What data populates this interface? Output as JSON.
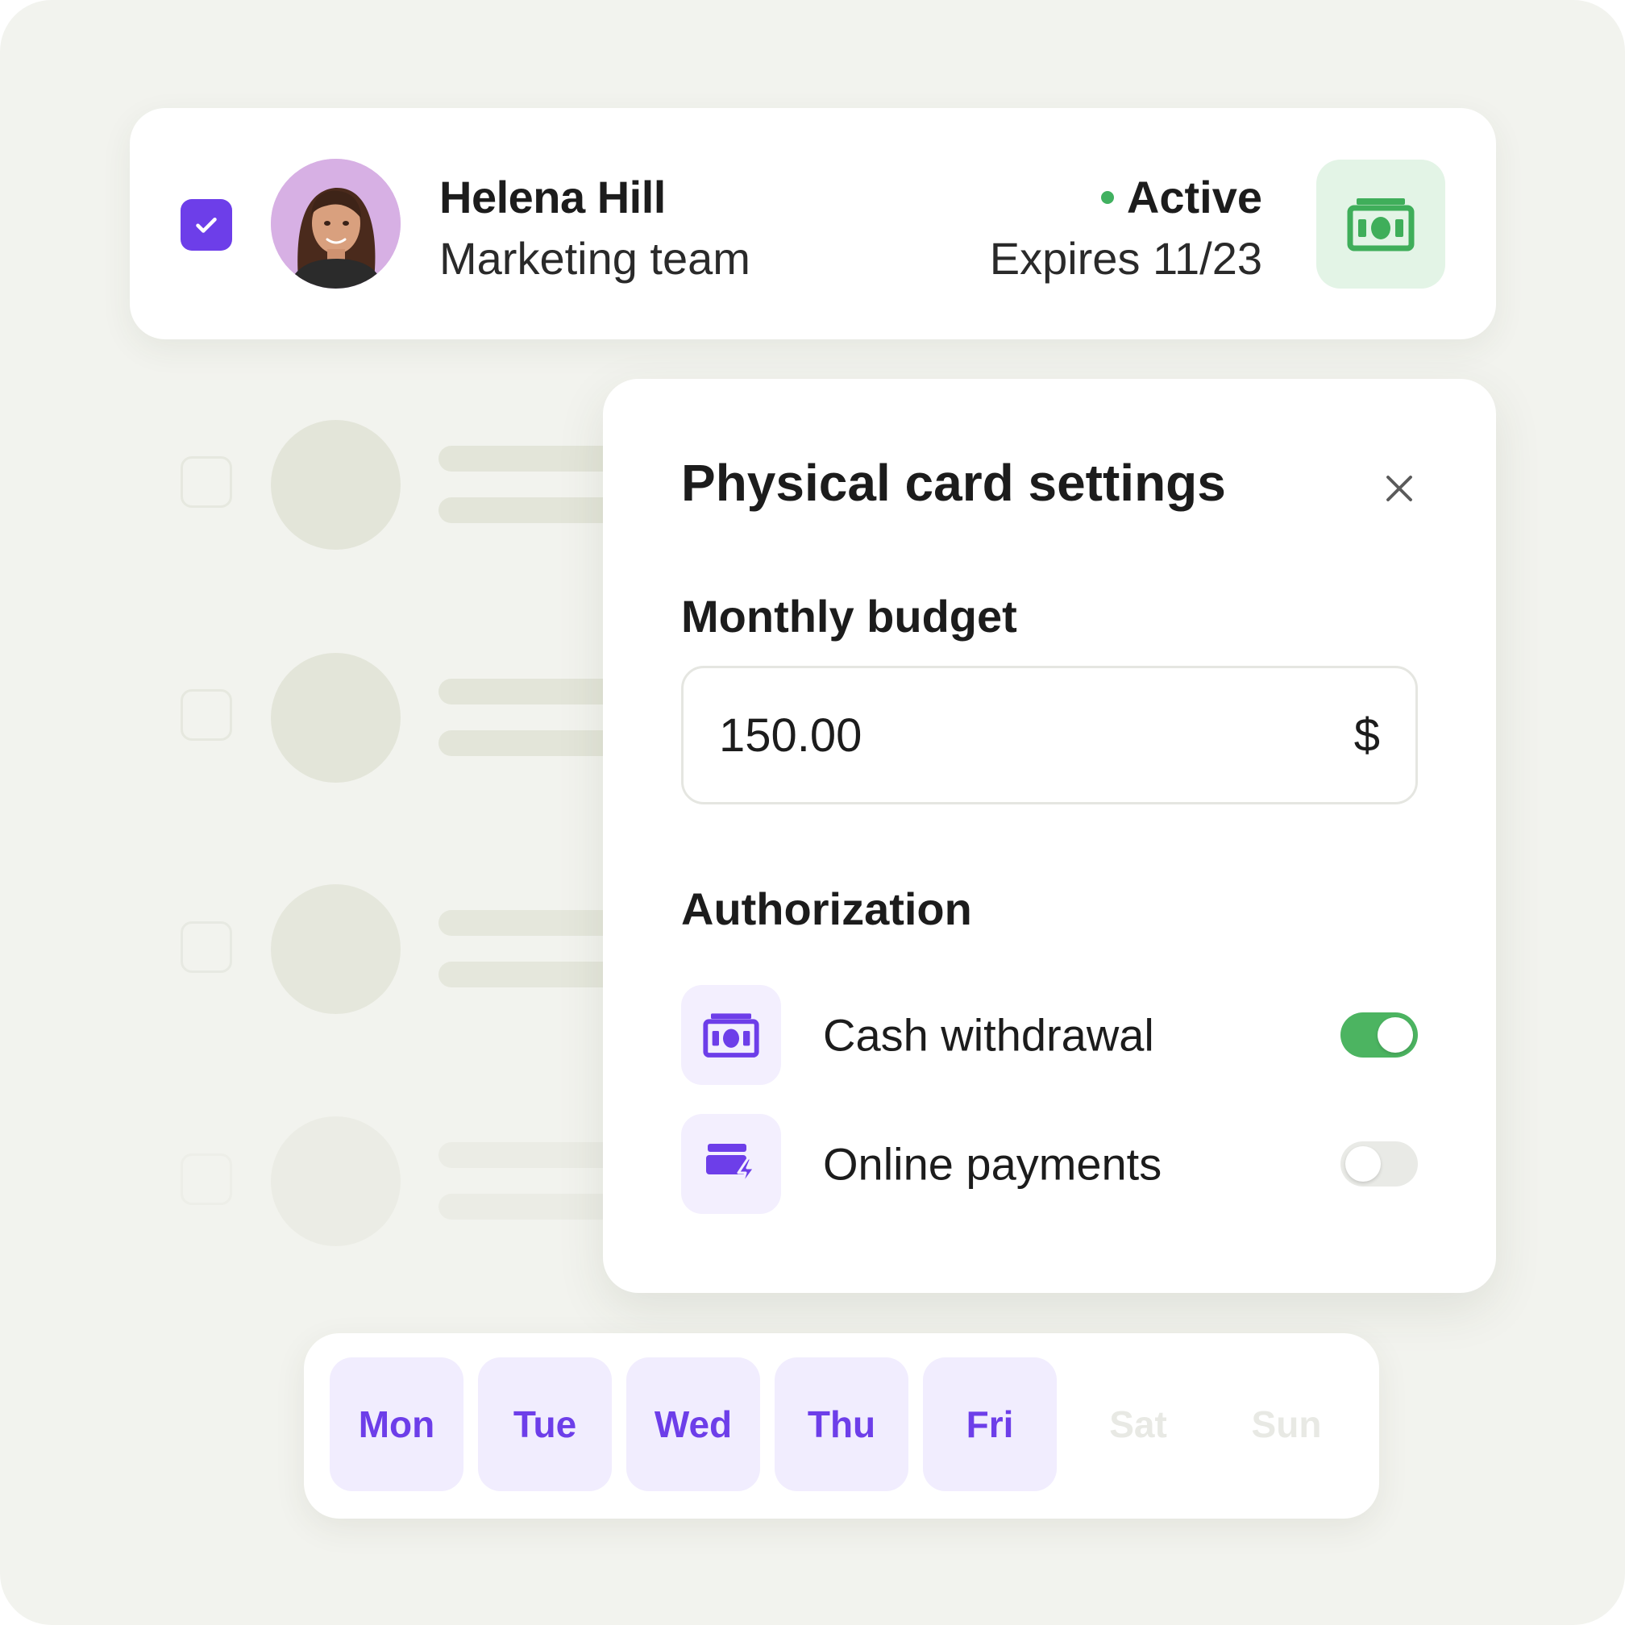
{
  "user": {
    "name": "Helena Hill",
    "team": "Marketing team",
    "status": "Active",
    "expires": "Expires 11/23",
    "selected": true
  },
  "settings": {
    "title": "Physical card settings",
    "budget_label": "Monthly budget",
    "budget_value": "150.00",
    "currency": "$",
    "authorization_label": "Authorization",
    "options": [
      {
        "label": "Cash withdrawal",
        "icon": "cash-icon",
        "enabled": true
      },
      {
        "label": "Online payments",
        "icon": "card-lightning-icon",
        "enabled": false
      }
    ]
  },
  "days": [
    {
      "label": "Mon",
      "active": true
    },
    {
      "label": "Tue",
      "active": true
    },
    {
      "label": "Wed",
      "active": true
    },
    {
      "label": "Thu",
      "active": true
    },
    {
      "label": "Fri",
      "active": true
    },
    {
      "label": "Sat",
      "active": false
    },
    {
      "label": "Sun",
      "active": false
    }
  ],
  "colors": {
    "accent": "#6d3ee9",
    "success": "#4cb461",
    "canvas": "#f2f3ee",
    "skeleton": "#e3e5d9"
  }
}
